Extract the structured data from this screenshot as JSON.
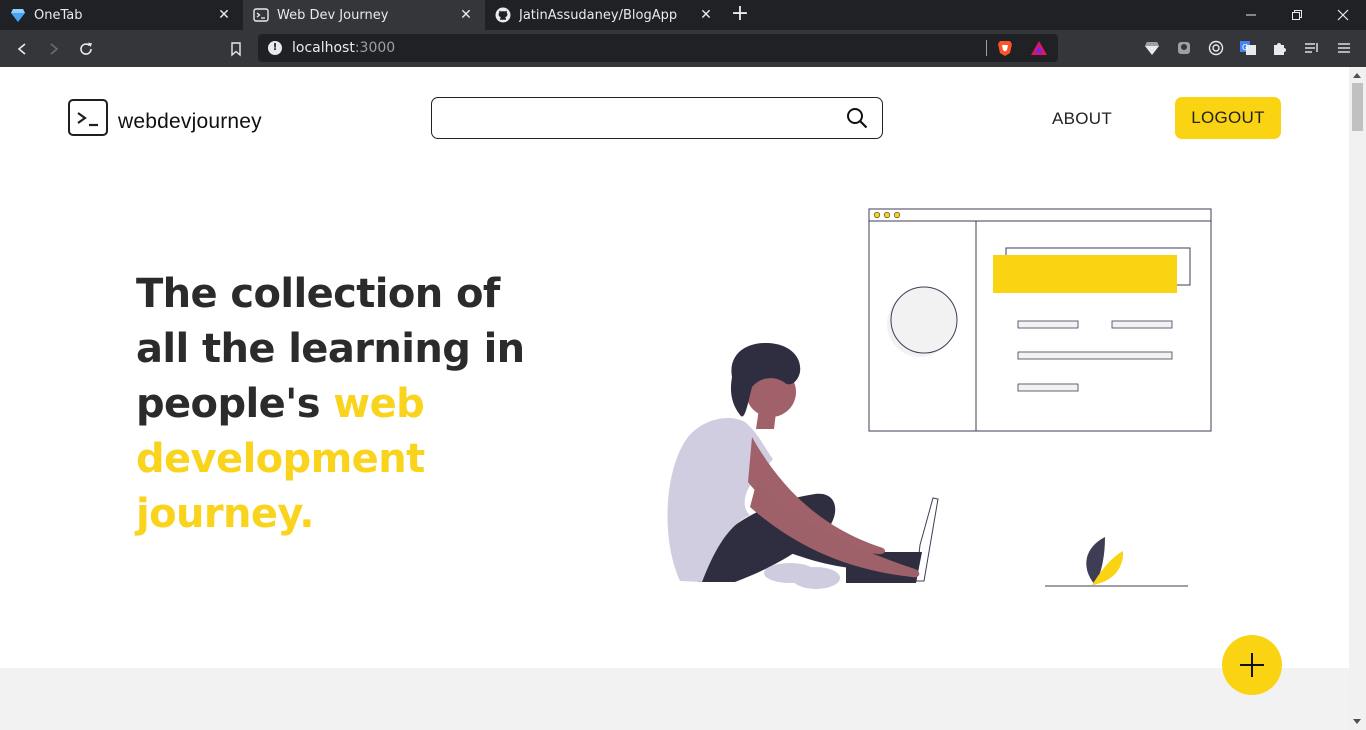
{
  "browser": {
    "tabs": [
      {
        "title": "OneTab",
        "icon": "onetab-diamond-icon",
        "active": false
      },
      {
        "title": "Web Dev Journey",
        "icon": "terminal-favicon-icon",
        "active": true
      },
      {
        "title": "JatinAssudaney/BlogApp",
        "icon": "github-icon",
        "active": false
      }
    ],
    "url_host": "localhost",
    "url_port": ":3000"
  },
  "header": {
    "logo_text": "webdevjourney",
    "search": {
      "value": "",
      "placeholder": ""
    },
    "about_label": "ABOUT",
    "logout_label": "LOGOUT"
  },
  "hero": {
    "title_prefix": "The collection of all the learning in people's ",
    "title_highlight": "web development journey."
  },
  "colors": {
    "accent": "#fad312",
    "text": "#2b2b2b",
    "browser_dark": "#202124",
    "browser_mid": "#35363a"
  },
  "fab": {
    "icon": "plus-icon"
  }
}
